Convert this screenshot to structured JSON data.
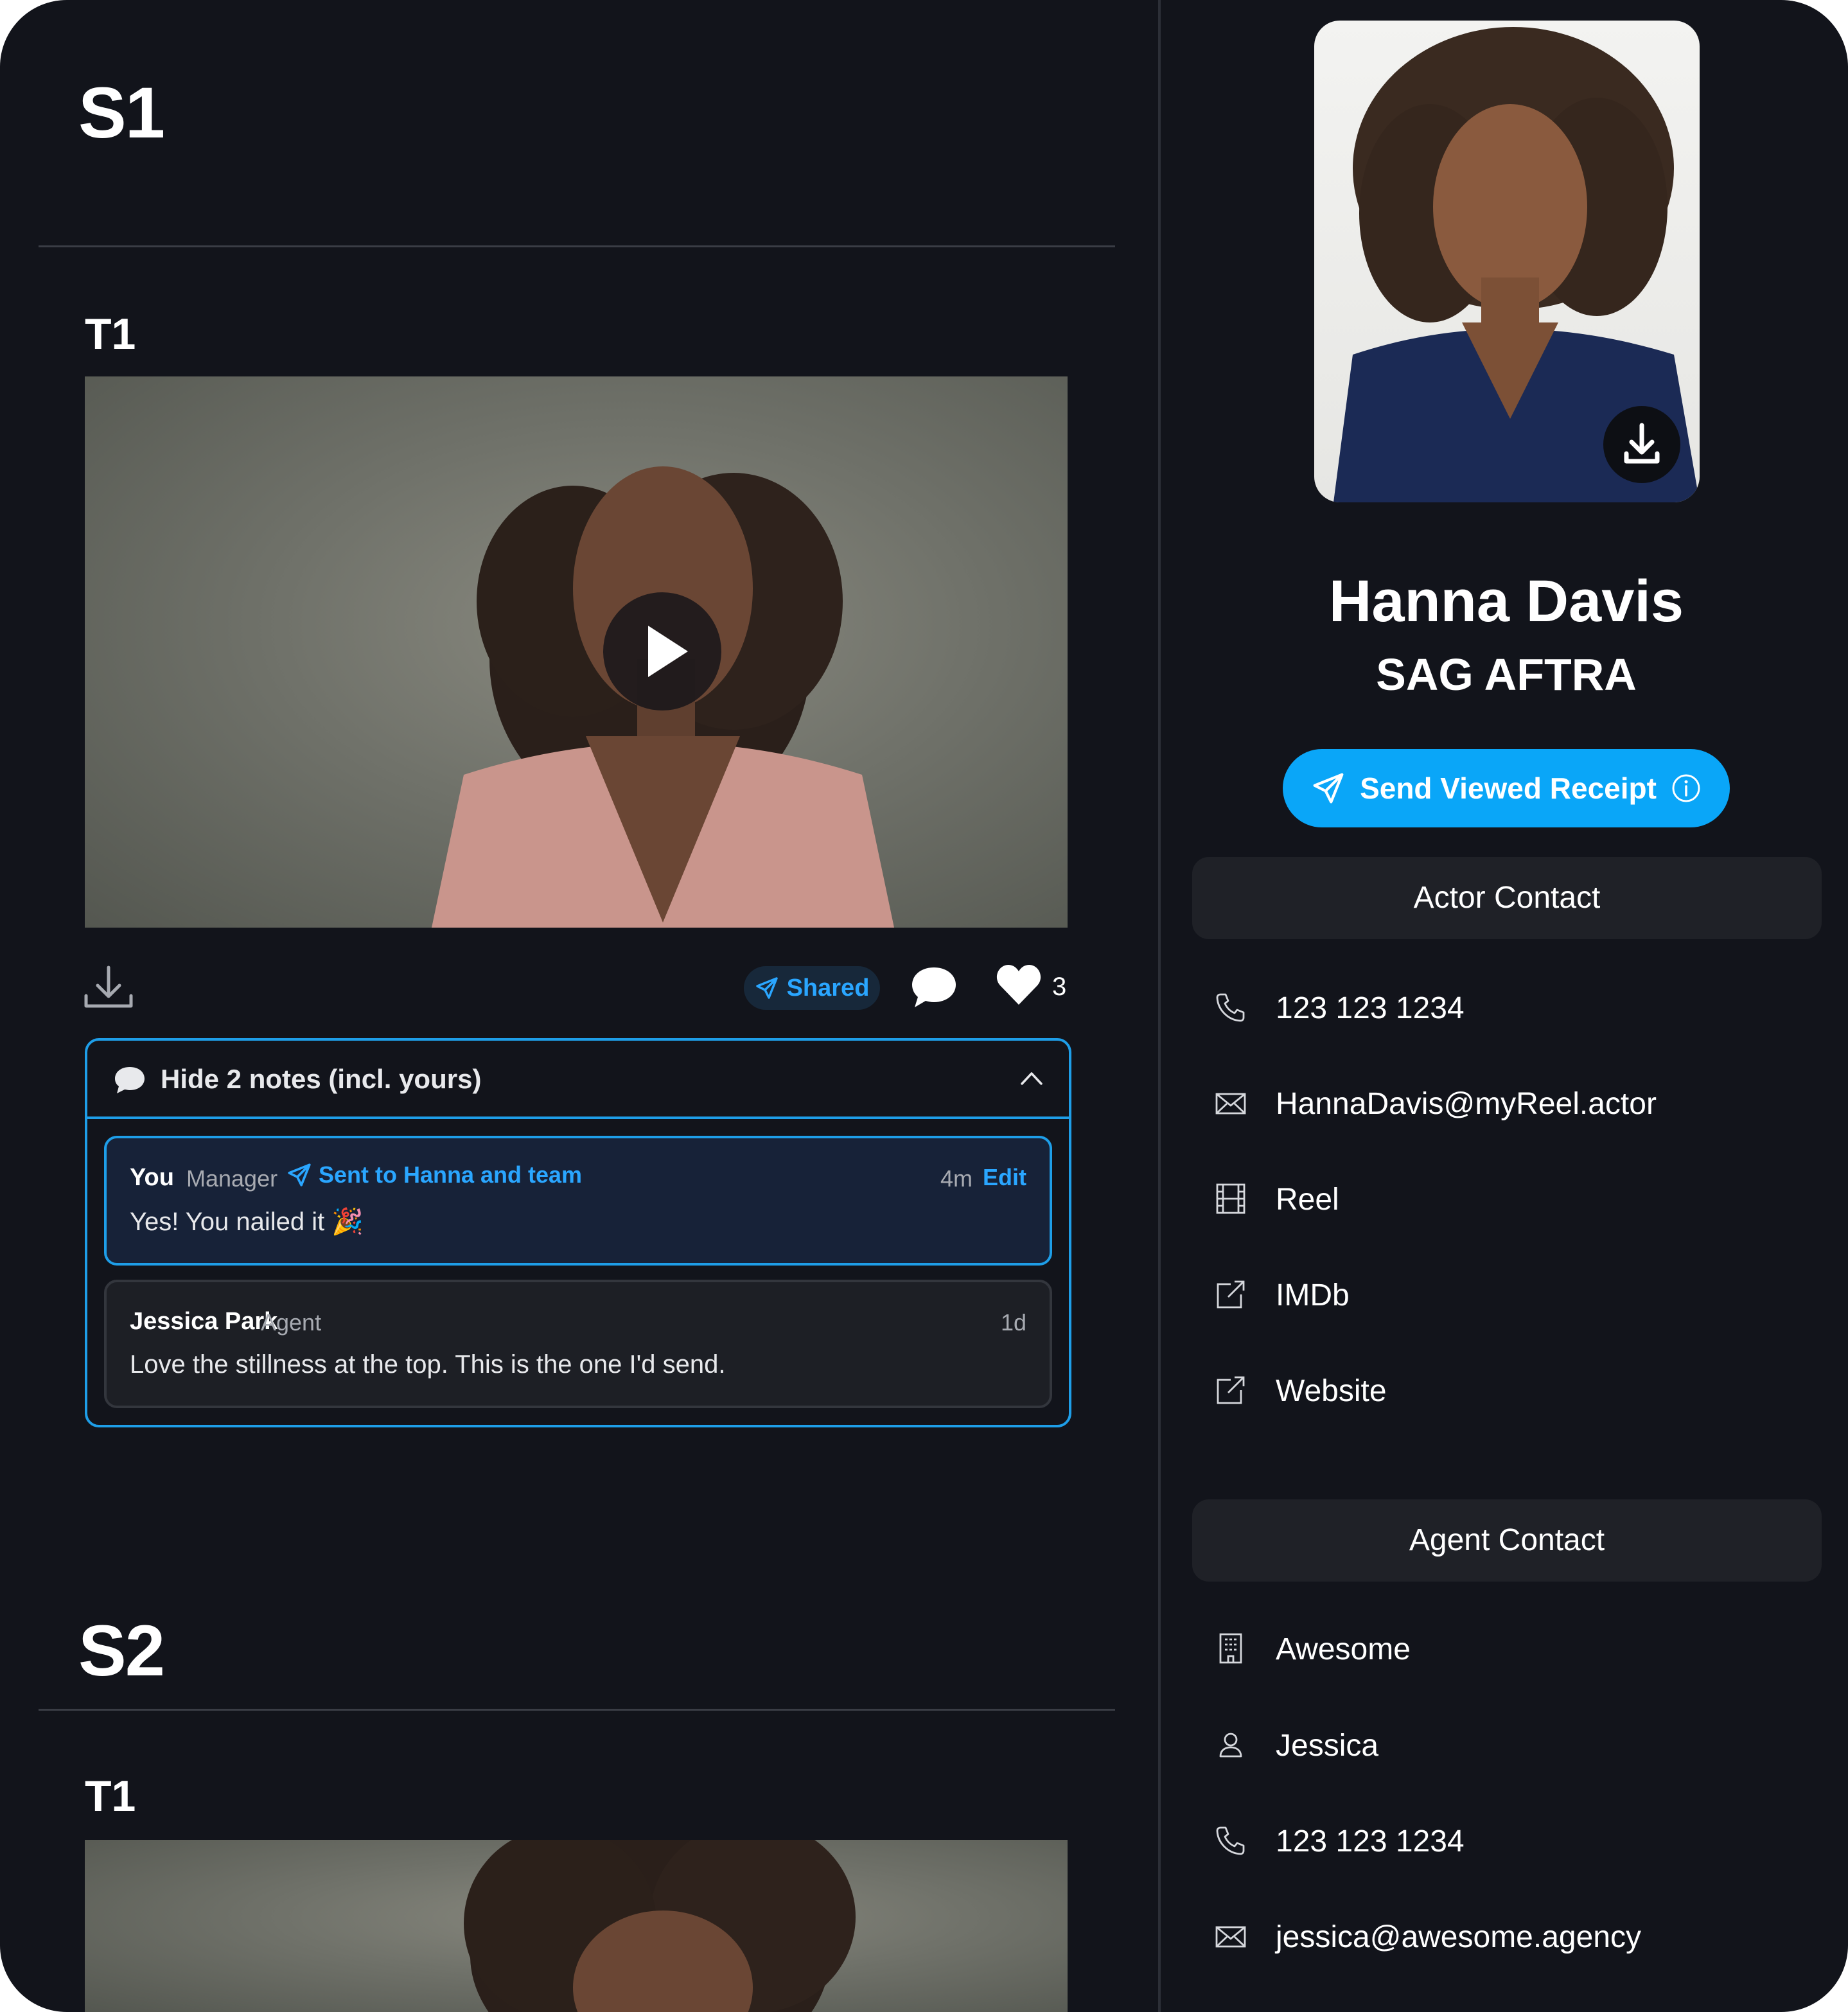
{
  "sections": [
    {
      "label": "S1",
      "take": {
        "label": "T1",
        "actions": {
          "shared_label": "Shared",
          "like_count": "3"
        },
        "notes": {
          "toggle_label": "Hide 2 notes (incl. yours)",
          "items": [
            {
              "author": "You",
              "role": "Manager",
              "sent_label": "Sent to Hanna and team",
              "time": "4m",
              "edit_label": "Edit",
              "text": "Yes! You nailed it 🎉"
            },
            {
              "author": "Jessica Park",
              "role": "Agent",
              "time": "1d",
              "text": "Love the stillness at the top. This is the one I'd send."
            }
          ]
        }
      }
    },
    {
      "label": "S2",
      "take": {
        "label": "T1"
      }
    }
  ],
  "profile": {
    "name": "Hanna Davis",
    "union": "SAG AFTRA",
    "send_receipt_label": "Send Viewed Receipt",
    "actor_contact": {
      "heading": "Actor Contact",
      "items": [
        {
          "icon": "phone-icon",
          "text": "123 123 1234"
        },
        {
          "icon": "mail-icon",
          "text": "HannaDavis@myReel.actor"
        },
        {
          "icon": "film-icon",
          "text": "Reel"
        },
        {
          "icon": "external-link-icon",
          "text": "IMDb"
        },
        {
          "icon": "external-link-icon",
          "text": "Website"
        }
      ]
    },
    "agent_contact": {
      "heading": "Agent Contact",
      "items": [
        {
          "icon": "building-icon",
          "text": "Awesome"
        },
        {
          "icon": "user-icon",
          "text": "Jessica"
        },
        {
          "icon": "phone-icon",
          "text": "123 123 1234"
        },
        {
          "icon": "mail-icon",
          "text": "jessica@awesome.agency"
        }
      ]
    }
  },
  "colors": {
    "background": "#12141b",
    "accent": "#0aa6f8",
    "link": "#2aa6ff",
    "panel": "#1f2127"
  }
}
